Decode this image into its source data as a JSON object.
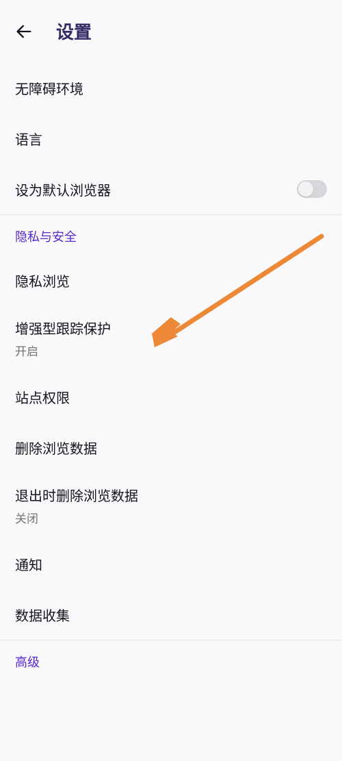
{
  "header": {
    "title": "设置"
  },
  "sections": {
    "general": {
      "accessibility": {
        "label": "无障碍环境"
      },
      "language": {
        "label": "语言"
      },
      "default_browser": {
        "label": "设为默认浏览器",
        "toggle_on": false
      }
    },
    "privacy_security": {
      "header": "隐私与安全",
      "private_browsing": {
        "label": "隐私浏览"
      },
      "enhanced_tracking": {
        "label": "增强型跟踪保护",
        "status": "开启"
      },
      "site_permissions": {
        "label": "站点权限"
      },
      "delete_browsing_data": {
        "label": "删除浏览数据"
      },
      "delete_on_quit": {
        "label": "退出时删除浏览数据",
        "status": "关闭"
      },
      "notifications": {
        "label": "通知"
      },
      "data_collection": {
        "label": "数据收集"
      }
    },
    "advanced": {
      "header": "高级"
    }
  }
}
